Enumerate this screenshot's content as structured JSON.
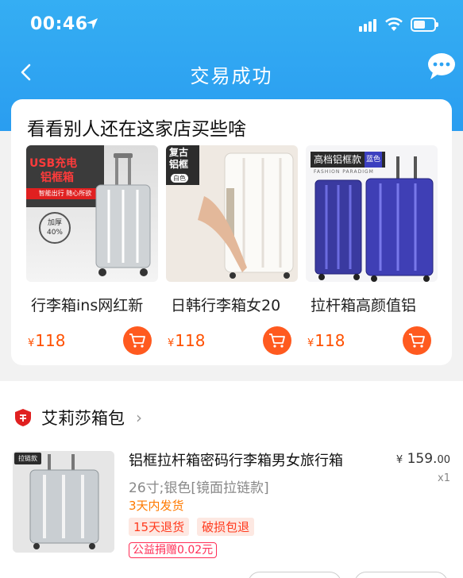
{
  "status_bar": {
    "time": "00:46"
  },
  "nav": {
    "title": "交易成功",
    "back_icon": "chevron-left-icon",
    "message_icon": "chat-bubble-icon"
  },
  "recommend": {
    "title": "看看别人还在这家店买些啥",
    "items": [
      {
        "name": "行李箱ins网红新",
        "currency": "¥",
        "price": "118",
        "badge_lines": [
          "USB充电",
          "铝框箱"
        ],
        "slogan": "智能出行 随心所欲",
        "circle": [
          "加厚",
          "40%"
        ]
      },
      {
        "name": "日韩行李箱女20",
        "currency": "¥",
        "price": "118",
        "badge_lines": [
          "复古",
          "铝框"
        ],
        "badge_sub": "白色"
      },
      {
        "name": "拉杆箱高颜值铝",
        "currency": "¥",
        "price": "118",
        "badge_main": "高档铝框款",
        "badge_color": "蓝色",
        "badge_en": "FASHION PARADIGM"
      }
    ]
  },
  "order": {
    "shop_name": "艾莉莎箱包",
    "shop_icon": "shop-badge-icon",
    "product": {
      "thumb_tag": "拉链款",
      "title": "铝框拉杆箱密码行李箱男女旅行箱",
      "currency": "¥",
      "price_int": "159.",
      "price_dec": "00",
      "qty": "x1",
      "spec": "26寸;银色[镜面拉链款]",
      "shipping": "3天内发货",
      "tags": [
        "15天退货",
        "破损包退"
      ],
      "charity": "公益捐赠0.02元"
    }
  },
  "colors": {
    "header_blue": "#2ea3f2",
    "price_orange": "#ff5000",
    "cart_orange": "#ff5a1f",
    "charity_red": "#ff2d55"
  }
}
